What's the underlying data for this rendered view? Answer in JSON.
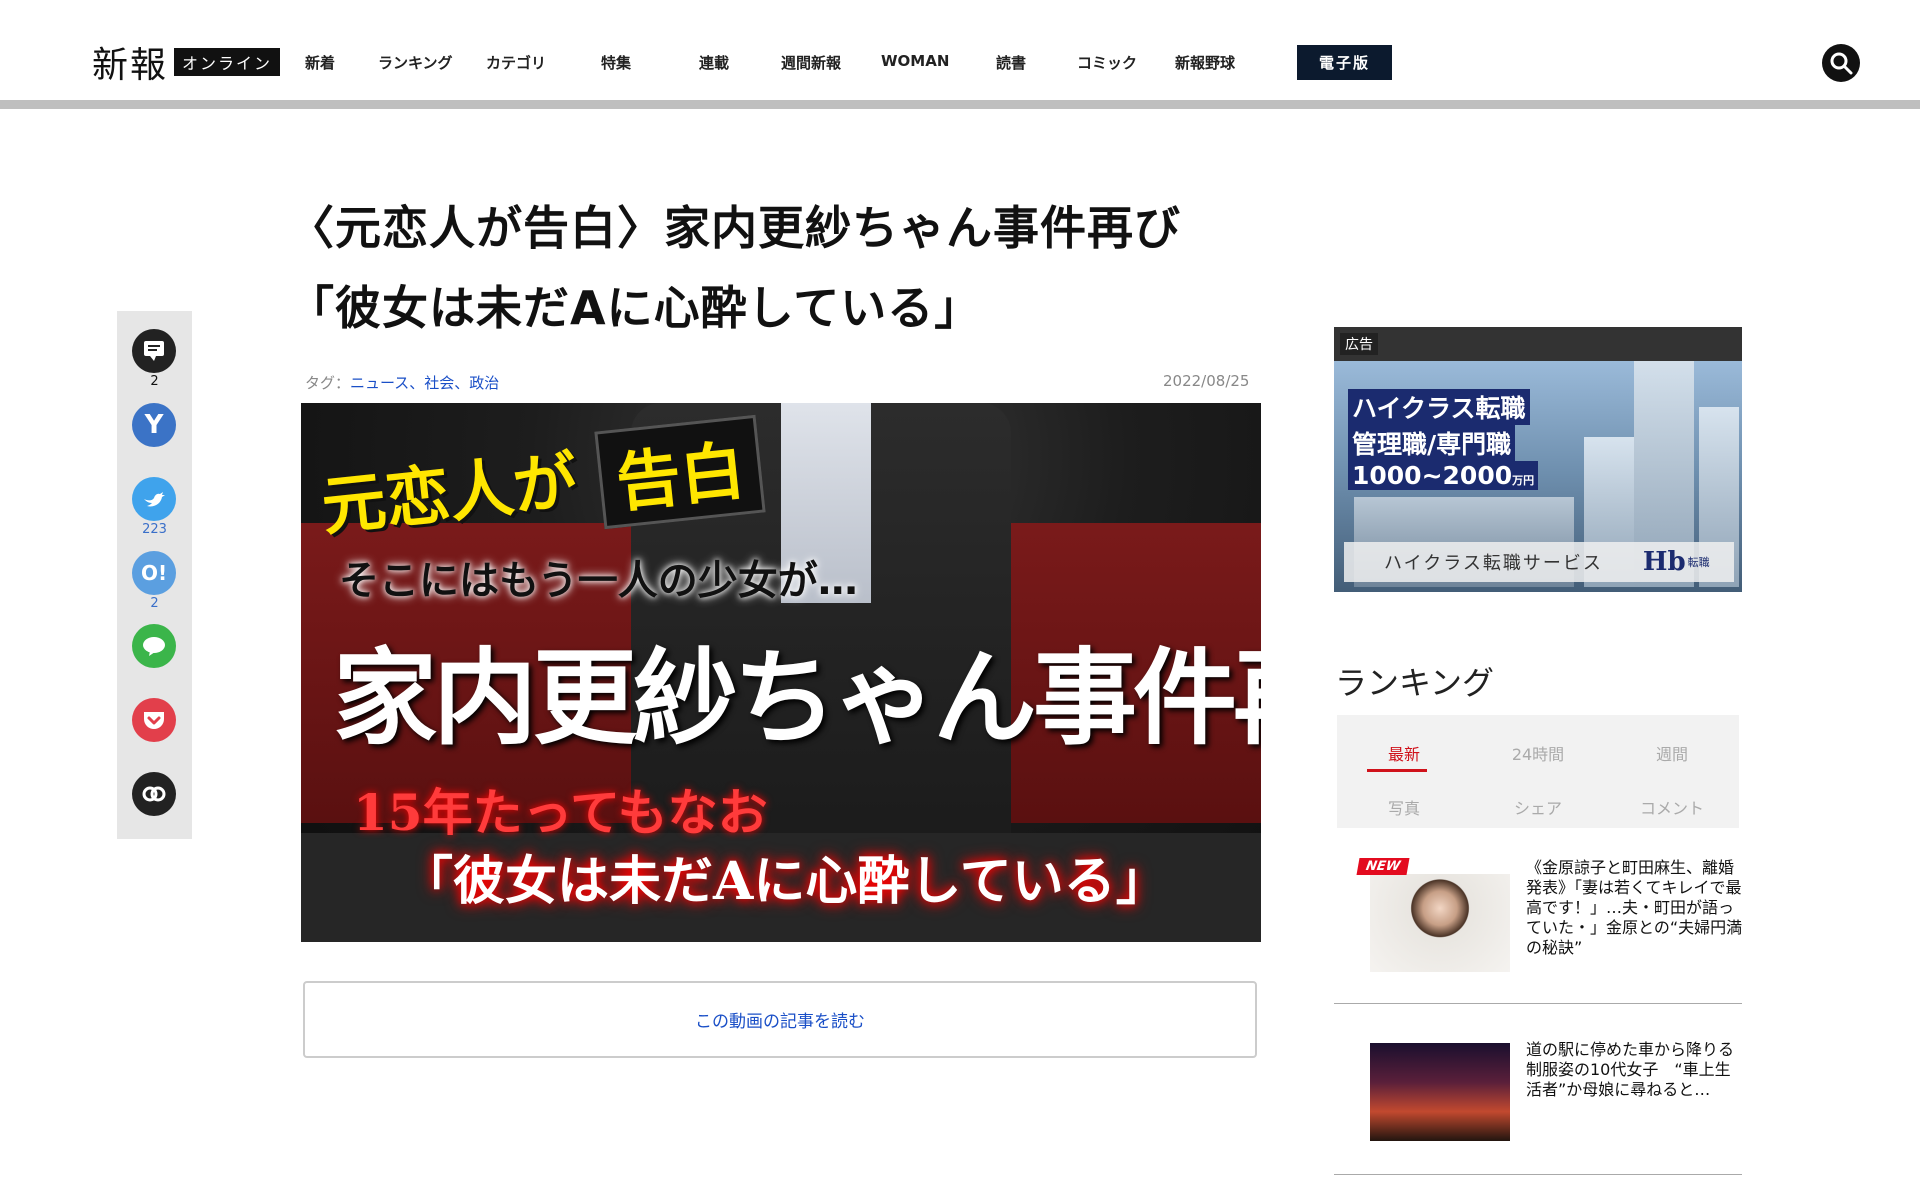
{
  "header": {
    "logo": "新報",
    "logo_sub": "オンライン",
    "nav": [
      "新着",
      "ランキング",
      "カテゴリ",
      "特集",
      "連載",
      "週間新報",
      "WOMAN",
      "読書",
      "コミック",
      "新報野球"
    ],
    "digital_label": "電子版"
  },
  "article": {
    "title_line1": "〈元恋人が告白〉家内更紗ちゃん事件再び",
    "title_line2": "「彼女は未だAに心酔している」",
    "tags_prefix": "タグ：",
    "tags": "ニュース、社会、政治",
    "date": "2022/08/25",
    "hero": {
      "line1a": "元恋人が",
      "line1b": "告白",
      "line2": "そこにはもう一人の少女が…",
      "line3": "家内更紗ちゃん事件再び",
      "line4": "15年たってもなお",
      "line5": "「彼女は未だAに心酔している」"
    },
    "read_button": "この動画の記事を読む"
  },
  "share": {
    "comment_count": "2",
    "twitter_count": "223",
    "hatena_count": "2",
    "icons": [
      "comment-icon",
      "yahoo-icon",
      "twitter-icon",
      "hatena-icon",
      "line-icon",
      "pocket-icon",
      "link-icon"
    ]
  },
  "ad": {
    "label": "広告",
    "line1": "ハイクラス転職",
    "line2": "管理職/専門職",
    "line3": "1000~2000",
    "line3_unit": "万円",
    "service": "ハイクラス転職サービス",
    "brand": "Hb",
    "brand_sub": "転職"
  },
  "ranking": {
    "title": "ランキング",
    "tabs": [
      "最新",
      "24時間",
      "週間",
      "写真",
      "シェア",
      "コメント"
    ],
    "badge": "NEW",
    "items": [
      "《金原諒子と町田麻生、離婚発表》「妻は若くてキレイで最高です！」…夫・町田が語っていた・」金原との“夫婦円満の秘訣”",
      "道の駅に停めた車から降りる制服姿の10代女子　“車上生活者”か母娘に尋ねると…"
    ]
  },
  "colors": {
    "accent_red": "#d0121b",
    "link_blue": "#1a4fc7",
    "nav_dark": "#0c1a2e"
  }
}
